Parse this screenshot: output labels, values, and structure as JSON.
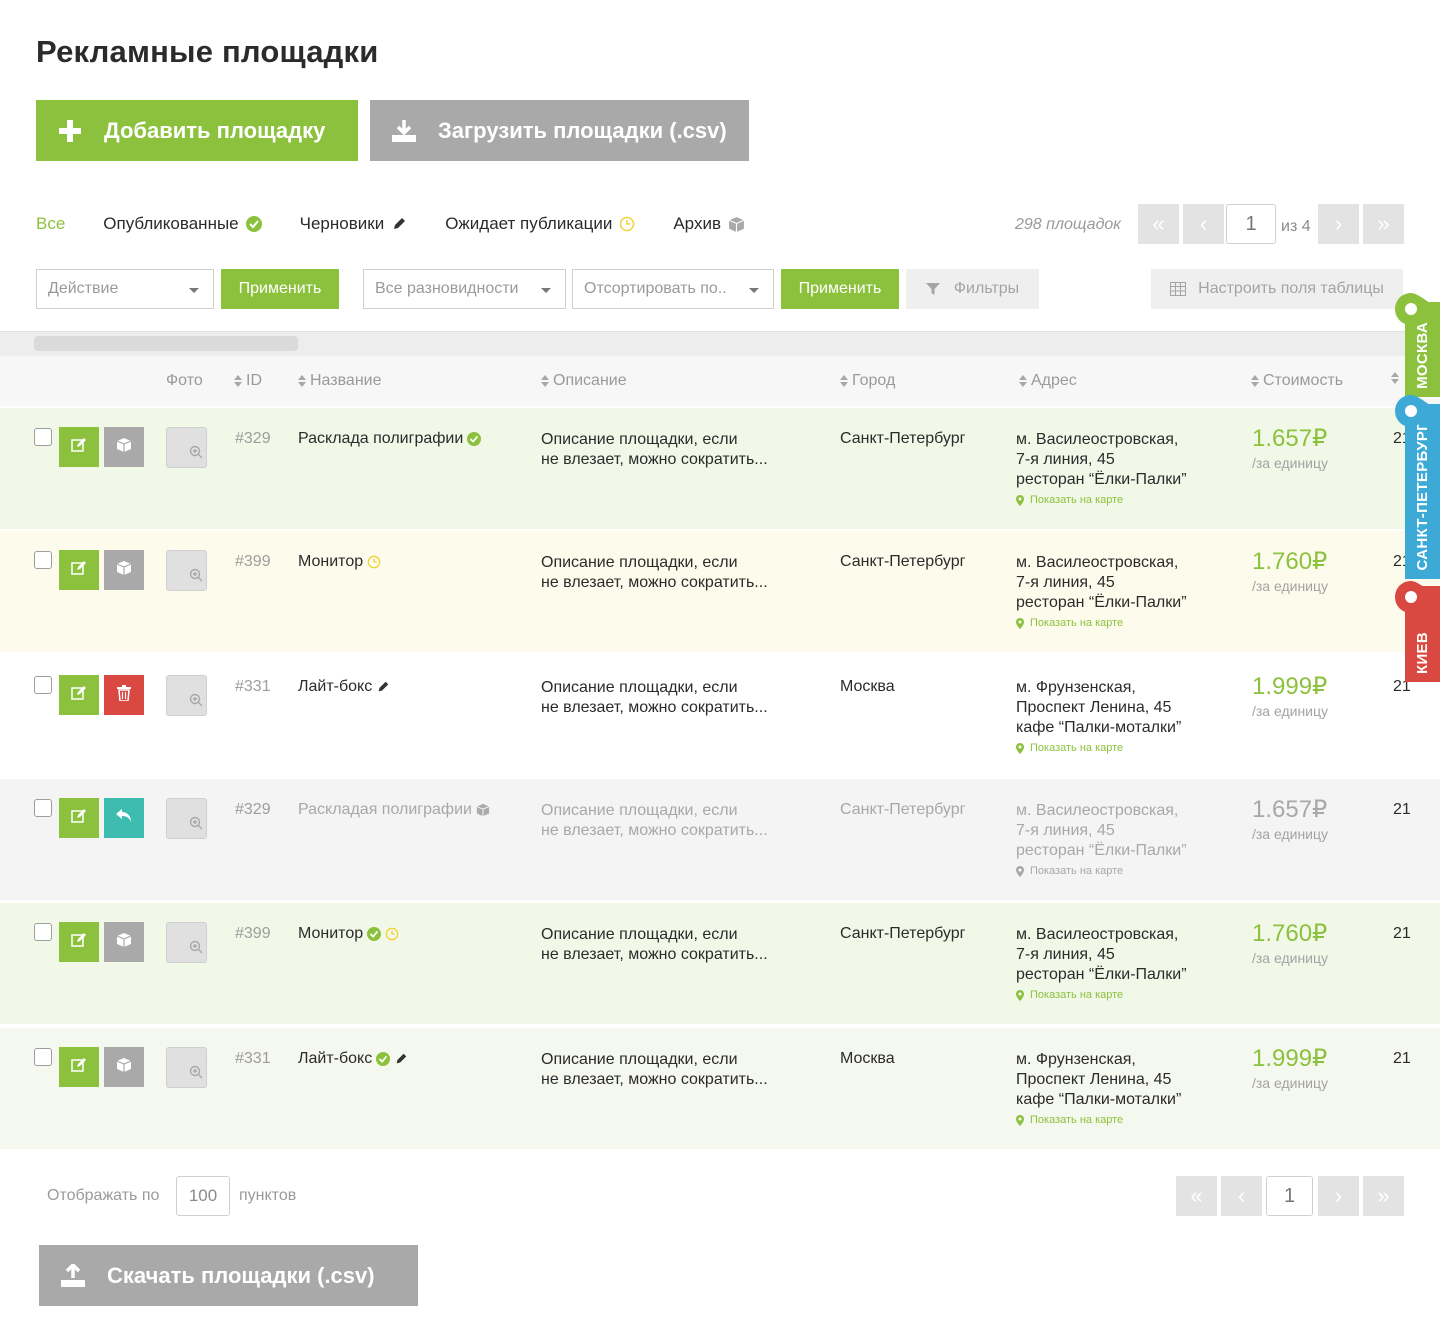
{
  "title": "Рекламные площадки",
  "actions": {
    "add_label": "Добавить площадку",
    "upload_label": "Загрузить площадки (.csv)",
    "download_label": "Скачать площадки (.csv)"
  },
  "tabs": [
    {
      "label": "Все",
      "active": true
    },
    {
      "label": "Опубликованные"
    },
    {
      "label": "Черновики"
    },
    {
      "label": "Ожидает публикации"
    },
    {
      "label": "Архив"
    }
  ],
  "pagination": {
    "count": "298 площадок",
    "page": "1",
    "of": "из 4"
  },
  "toolbar": {
    "action_placeholder": "Действие",
    "apply": "Применить",
    "variety_placeholder": "Все разновидности",
    "sort_placeholder": "Отсортировать по..",
    "filters": "Фильтры",
    "configure": "Настроить поля таблицы"
  },
  "columns": {
    "photo": "Фото",
    "id": "ID",
    "name": "Название",
    "desc": "Описание",
    "city": "Город",
    "address": "Адрес",
    "price": "Стоимость"
  },
  "rows": [
    {
      "id": "#329",
      "name": "Расклада полиграфии",
      "desc1": "Описание площадки, если",
      "desc2": "не влезает, можно сократить...",
      "city": "Санкт-Петербург",
      "addr1": "м. Василеостровская,",
      "addr2": "7-я линия, 45",
      "addr3": "ресторан “Ёлки-Палки”",
      "map": "Показать на карте",
      "price": "1.657₽",
      "unit": "/за единицу",
      "num": "21"
    },
    {
      "id": "#399",
      "name": "Монитор",
      "desc1": "Описание площадки, если",
      "desc2": "не влезает, можно сократить...",
      "city": "Санкт-Петербург",
      "addr1": "м. Василеостровская,",
      "addr2": "7-я линия, 45",
      "addr3": "ресторан “Ёлки-Палки”",
      "map": "Показать на карте",
      "price": "1.760₽",
      "unit": "/за единицу",
      "num": "21"
    },
    {
      "id": "#331",
      "name": "Лайт-бокс",
      "desc1": "Описание площадки, если",
      "desc2": "не влезает, можно сократить...",
      "city": "Москва",
      "addr1": "м. Фрунзенская,",
      "addr2": "Проспект Ленина, 45",
      "addr3": "кафе “Палки-моталки”",
      "map": "Показать на карте",
      "price": "1.999₽",
      "unit": "/за единицу",
      "num": "21"
    },
    {
      "id": "#329",
      "name": "Раскладая полиграфии",
      "desc1": "Описание площадки, если",
      "desc2": "не влезает, можно сократить...",
      "city": "Санкт-Петербург",
      "addr1": "м. Василеостровская,",
      "addr2": "7-я линия, 45",
      "addr3": "ресторан “Ёлки-Палки”",
      "map": "Показать на карте",
      "price": "1.657₽",
      "unit": "/за единицу",
      "num": "21"
    },
    {
      "id": "#399",
      "name": "Монитор",
      "desc1": "Описание площадки, если",
      "desc2": "не влезает, можно сократить...",
      "city": "Санкт-Петербург",
      "addr1": "м. Василеостровская,",
      "addr2": "7-я линия, 45",
      "addr3": "ресторан “Ёлки-Палки”",
      "map": "Показать на карте",
      "price": "1.760₽",
      "unit": "/за единицу",
      "num": "21"
    },
    {
      "id": "#331",
      "name": "Лайт-бокс",
      "desc1": "Описание площадки, если",
      "desc2": "не влезает, можно сократить...",
      "city": "Москва",
      "addr1": "м. Фрунзенская,",
      "addr2": "Проспект Ленина, 45",
      "addr3": "кафе “Палки-моталки”",
      "map": "Показать на карте",
      "price": "1.999₽",
      "unit": "/за единицу",
      "num": "21"
    }
  ],
  "footer": {
    "show_label": "Отображать по",
    "per_page": "100",
    "unit": "пунктов",
    "page": "1"
  },
  "city_flags": [
    {
      "label": "МОСКВА",
      "color": "#8cc13e"
    },
    {
      "label": "САНКТ-ПЕТЕРБУРГ",
      "color": "#3da9d6"
    },
    {
      "label": "КИЕВ",
      "color": "#d94841"
    }
  ],
  "colors": {
    "accent": "#8cc13e",
    "muted_button": "#a9a9a9",
    "danger": "#d94841",
    "restore": "#3ebcb0",
    "pending": "#f0d23a"
  }
}
